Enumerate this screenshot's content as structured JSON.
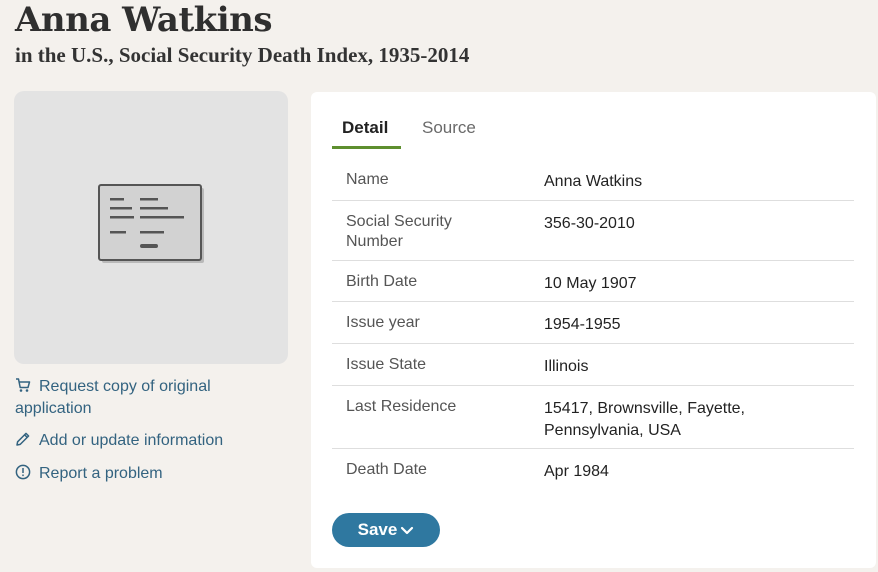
{
  "header": {
    "name": "Anna Watkins",
    "collection": "in the U.S., Social Security Death Index, 1935-2014"
  },
  "sidebar": {
    "request_copy": "Request copy of original application",
    "add_update": "Add or update information",
    "report_problem": "Report a problem"
  },
  "tabs": {
    "detail": "Detail",
    "source": "Source"
  },
  "facts": {
    "name_label": "Name",
    "name_value": "Anna Watkins",
    "ssn_label": "Social Security Number",
    "ssn_value": "356-30-2010",
    "birth_label": "Birth Date",
    "birth_value": "10 May 1907",
    "issue_year_label": "Issue year",
    "issue_year_value": "1954-1955",
    "issue_state_label": "Issue State",
    "issue_state_value": "Illinois",
    "residence_label": "Last Residence",
    "residence_value": "15417, Brownsville, Fayette, Pennsylvania, USA",
    "death_label": "Death Date",
    "death_value": "Apr 1984"
  },
  "actions": {
    "save_label": "Save"
  },
  "icons": {
    "record": "document-card-icon",
    "cart": "cart-icon",
    "pencil": "pencil-icon",
    "alert": "alert-circle-icon",
    "chevron": "chevron-down-icon"
  },
  "colors": {
    "link": "#336380",
    "tab_accent": "#5e8f2f",
    "save_button": "#2f78a0",
    "page_bg": "#f4f1ed"
  }
}
